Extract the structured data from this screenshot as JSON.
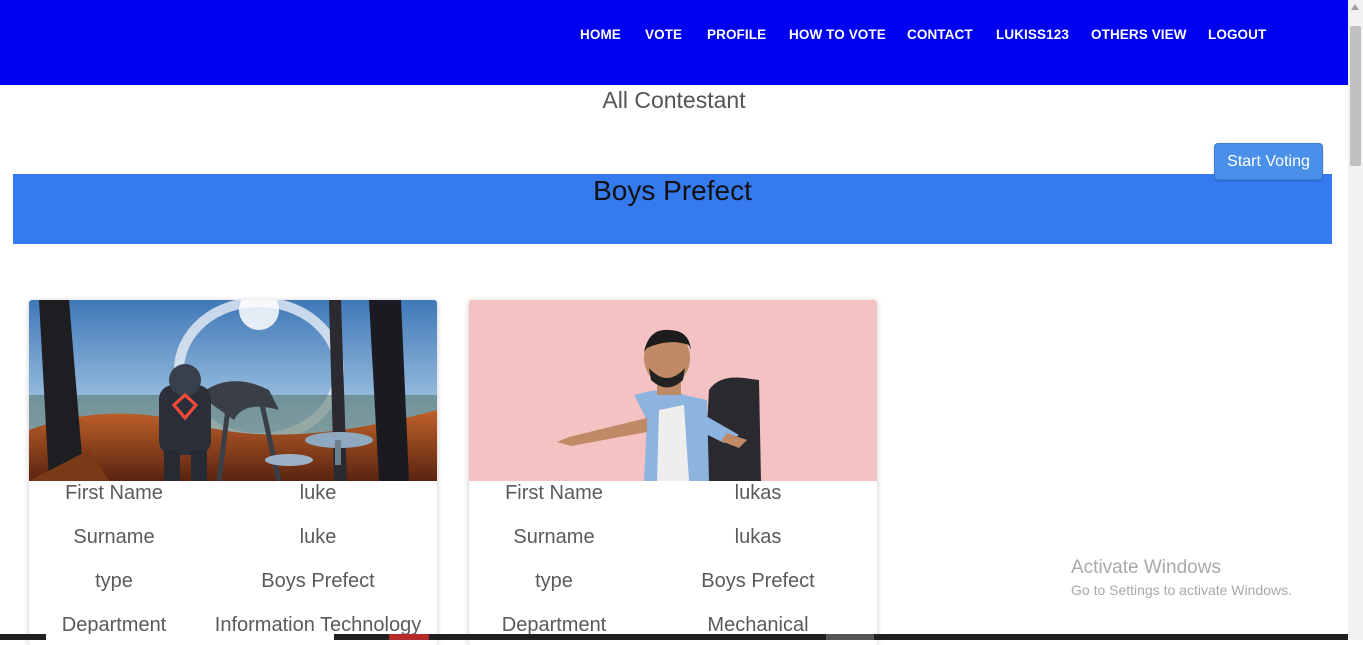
{
  "nav": {
    "items": [
      {
        "label": "HOME"
      },
      {
        "label": "VOTE"
      },
      {
        "label": "PROFILE"
      },
      {
        "label": "HOW TO VOTE"
      },
      {
        "label": "CONTACT"
      },
      {
        "label": "LUKISS123"
      },
      {
        "label": "OTHERS VIEW"
      },
      {
        "label": "LOGOUT"
      }
    ]
  },
  "page": {
    "title": "All Contestant",
    "start_button": "Start Voting"
  },
  "section": {
    "title": "Boys Prefect"
  },
  "contestants": [
    {
      "image": "sci-fi-astronaut-landscape",
      "rows": [
        {
          "label": "First Name",
          "value": "luke"
        },
        {
          "label": "Surname",
          "value": "luke"
        },
        {
          "label": "type",
          "value": "Boys Prefect"
        },
        {
          "label": "Department",
          "value": "Information Technology"
        }
      ]
    },
    {
      "image": "man-with-backpack-photo",
      "rows": [
        {
          "label": "First Name",
          "value": "lukas"
        },
        {
          "label": "Surname",
          "value": "lukas"
        },
        {
          "label": "type",
          "value": "Boys Prefect"
        },
        {
          "label": "Department",
          "value": "Mechanical"
        }
      ]
    }
  ],
  "watermark": {
    "title": "Activate Windows",
    "subtitle": "Go to Settings to activate Windows."
  },
  "colors": {
    "nav_bg": "#0000f2",
    "banner_bg": "#367aef",
    "button_bg": "#4a8fe9",
    "card2_image_bg": "#f4c2c2"
  }
}
